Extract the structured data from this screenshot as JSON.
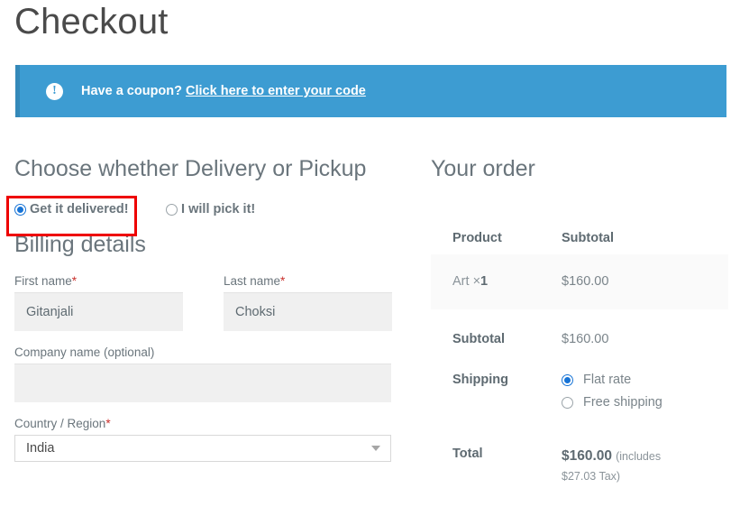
{
  "page": {
    "title": "Checkout"
  },
  "coupon": {
    "icon": "exclamation-circle-icon",
    "icon_glyph": "!",
    "prompt": "Have a coupon?",
    "link_text": "Click here to enter your code",
    "background_color": "#3d9cd2",
    "border_color": "#3489b9"
  },
  "delivery": {
    "heading": "Choose whether Delivery or Pickup",
    "options": [
      {
        "label": "Get it delivered!",
        "selected": true
      },
      {
        "label": "I will pick it!",
        "selected": false
      }
    ],
    "highlight_color": "#ee0000",
    "radio_accent": "#1673d6"
  },
  "billing": {
    "heading": "Billing details",
    "fields": [
      {
        "label": "First name",
        "required": true,
        "required_mark": "*",
        "value": "Gitanjali",
        "placeholder": ""
      },
      {
        "label": "Last name",
        "required": true,
        "required_mark": "*",
        "value": "Choksi",
        "placeholder": ""
      },
      {
        "label": "Company name (optional)",
        "required": false,
        "required_mark": "",
        "value": "",
        "placeholder": ""
      },
      {
        "label": "Country / Region",
        "required": true,
        "required_mark": "*",
        "value": "India",
        "placeholder": ""
      }
    ]
  },
  "order": {
    "heading": "Your order",
    "columns": {
      "product": "Product",
      "subtotal": "Subtotal"
    },
    "items": [
      {
        "name": "Art",
        "quantity_separator": "×",
        "quantity": "1",
        "subtotal": "$160.00"
      }
    ],
    "subtotal": {
      "label": "Subtotal",
      "value": "$160.00"
    },
    "shipping": {
      "label": "Shipping",
      "options": [
        {
          "label": "Flat rate",
          "selected": true
        },
        {
          "label": "Free shipping",
          "selected": false
        }
      ]
    },
    "total": {
      "label": "Total",
      "amount": "$160.00",
      "tax_note_line1": "(includes",
      "tax_note_line2": "$27.03 Tax)"
    }
  }
}
